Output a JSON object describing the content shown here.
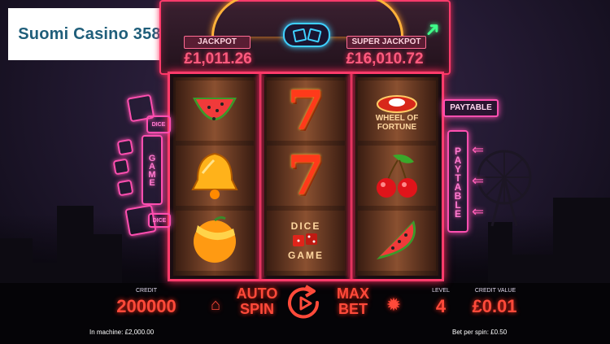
{
  "logo": {
    "text": "Suomi Casino 358"
  },
  "jackpots": {
    "jackpot_label": "JACKPOT",
    "jackpot_value": "£1,011.26",
    "super_label": "SUPER JACKPOT",
    "super_value": "£16,010.72"
  },
  "reels": {
    "symbols": [
      [
        "watermelon",
        "bell",
        "orange"
      ],
      [
        "seven",
        "seven",
        "dice-game"
      ],
      [
        "wheel-of-fortune",
        "cherries",
        "watermelon"
      ]
    ],
    "seven_glyph": "7",
    "wheel_of_fortune": "WHEEL OF FORTUNE",
    "dice_game": {
      "line1": "DICE",
      "line2": "GAME"
    }
  },
  "side": {
    "left_sign": {
      "dice_top": "DICE",
      "game": "GAME",
      "dice_bottom": "DICE"
    },
    "paytable_button": "PAYTABLE",
    "paytable_vertical": "PAYTABLE"
  },
  "panel": {
    "credit_label": "CREDIT",
    "credit_value": "200000",
    "auto_spin_line1": "AUTO",
    "auto_spin_line2": "SPIN",
    "max_bet_line1": "MAX",
    "max_bet_line2": "BET",
    "level_label": "LEVEL",
    "level_value": "4",
    "credit_value_label": "CREDIT VALUE",
    "credit_value_amount": "£0.01",
    "in_machine": "In machine: £2,000.00",
    "bet_per_spin": "Bet per spin: £0.50"
  },
  "colors": {
    "neon_red": "#ff4a3a",
    "neon_pink": "#ff4fb0",
    "neon_blue": "#3fd0ff",
    "logo_text": "#1f5e7a"
  },
  "icons": [
    "home-icon",
    "spin-icon",
    "settings-gear-icon",
    "arrow-icon"
  ]
}
